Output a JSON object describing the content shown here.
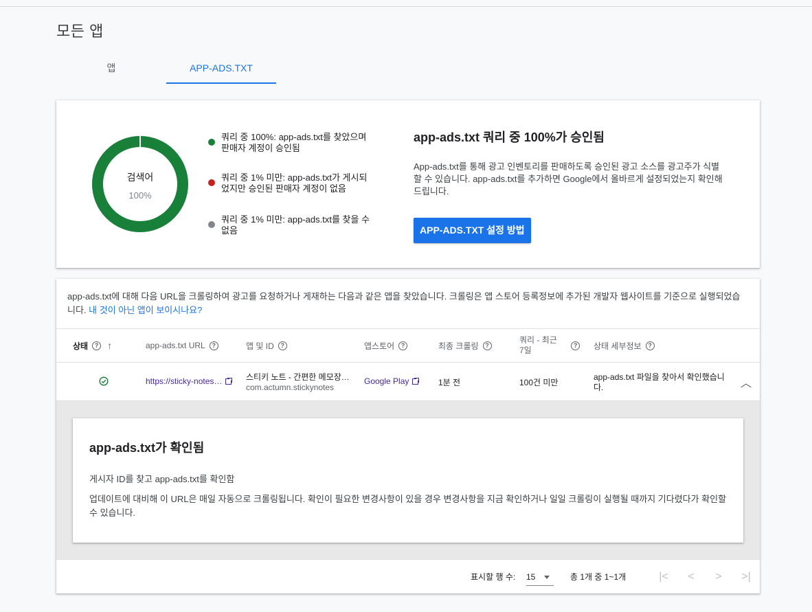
{
  "page_title": "모든 앱",
  "tabs": [
    {
      "label": "앱",
      "active": false
    },
    {
      "label": "APP-ADS.TXT",
      "active": true
    }
  ],
  "summary": {
    "donut": {
      "label": "검색어",
      "value": "100%",
      "approved_fraction": 1.0,
      "color": "#188038"
    },
    "legend": [
      {
        "color": "#188038",
        "text": "쿼리 중 100%: app-ads.txt를 찾았으며 판매자 계정이 승인됨"
      },
      {
        "color": "#c5221f",
        "text": "쿼리 중 1% 미만: app-ads.txt가 게시되었지만 승인된 판매자 계정이 없음"
      },
      {
        "color": "#80868b",
        "text": "쿼리 중 1% 미만: app-ads.txt를 찾을 수 없음"
      }
    ],
    "title": "app-ads.txt 쿼리 중 100%가 승인됨",
    "description": "App-ads.txt를 통해 광고 인벤토리를 판매하도록 승인된 광고 소스를 광고주가 식별할 수 있습니다. app-ads.txt를 추가하면 Google에서 올바르게 설정되었는지 확인해 드립니다.",
    "button_label": "APP-ADS.TXT 설정 방법"
  },
  "table": {
    "intro": "app-ads.txt에 대해 다음 URL을 크롤링하여 광고를 요청하거나 게재하는 다음과 같은 앱을 찾았습니다. 크롤링은 앱 스토어 등록정보에 추가된 개발자 웹사이트를 기준으로 실행되었습니다.",
    "intro_link": "내 것이 아닌 앱이 보이시나요?",
    "columns": [
      "상태",
      "app-ads.txt URL",
      "앱 및 ID",
      "앱스토어",
      "최종 크롤링",
      "쿼리 - 최근 7일",
      "상태 세부정보"
    ],
    "rows": [
      {
        "status_icon": "check-circle-icon",
        "url": "https://sticky-notes…",
        "app_name": "스티키 노트 - 간편한 메모장…",
        "app_id": "com.actumn.stickynotes",
        "store": "Google Play",
        "last_crawl": "1분 전",
        "queries": "100건 미만",
        "status_detail": "app-ads.txt 파일을 찾아서 확인했습니다."
      }
    ],
    "detail": {
      "title": "app-ads.txt가 확인됨",
      "line1": "게시자 ID를 찾고 app-ads.txt를 확인함",
      "line2": "업데이트에 대비해 이 URL은 매일 자동으로 크롤링됩니다. 확인이 필요한 변경사항이 있을 경우 변경사항을 지금 확인하거나 일일 크롤링이 실행될 때까지 기다렸다가 확인할 수 있습니다."
    },
    "footer": {
      "rows_label": "표시할 행 수:",
      "rows_value": "15",
      "range": "총 1개 중 1~1개"
    }
  }
}
